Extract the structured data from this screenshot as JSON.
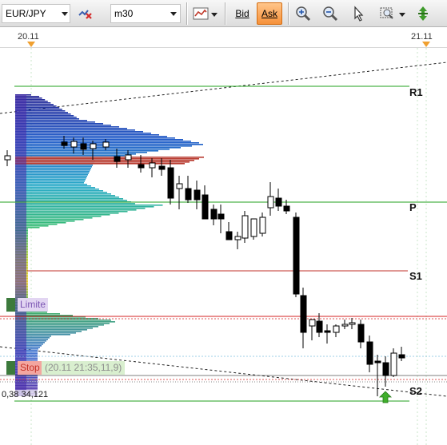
{
  "toolbar": {
    "symbol": "EUR/JPY",
    "timeframe": "m30",
    "bid_label": "Bid",
    "ask_label": "Ask",
    "ask_active": true,
    "icons": [
      "indicator-off-icon",
      "chart-type-icon",
      "zoom-in-icon",
      "zoom-out-icon",
      "cursor-icon",
      "zoom-area-icon",
      "autoscroll-icon"
    ]
  },
  "dates": {
    "left": "20.11",
    "right": "21.11"
  },
  "levels": {
    "r1": "R1",
    "p": "P",
    "s1": "S1",
    "s2": "S2"
  },
  "orders": {
    "limit_label": "Limite",
    "stop_label": "Stop",
    "stop_info": "(20.11 21:35,11,9)"
  },
  "volume_readout": "0,38  34,121",
  "colors": {
    "ask_active": "#f6913a",
    "pivot_lines": "#22a01e",
    "support_lines": "#d42020",
    "candle_bull": "#ffffff",
    "candle_bear": "#000000"
  }
}
